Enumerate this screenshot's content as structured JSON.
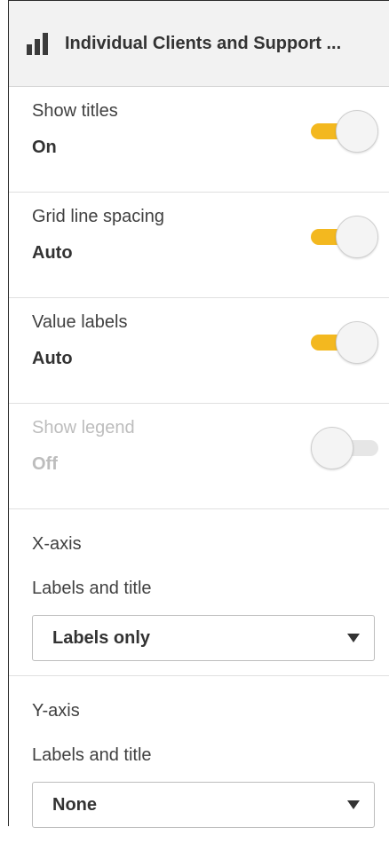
{
  "header": {
    "title": "Individual Clients and Support ..."
  },
  "settings": [
    {
      "label": "Show titles",
      "value": "On",
      "state": "on"
    },
    {
      "label": "Grid line spacing",
      "value": "Auto",
      "state": "on"
    },
    {
      "label": "Value labels",
      "value": "Auto",
      "state": "on"
    },
    {
      "label": "Show legend",
      "value": "Off",
      "state": "off"
    }
  ],
  "x_axis": {
    "title": "X-axis",
    "sub_label": "Labels and title",
    "selected": "Labels only"
  },
  "y_axis": {
    "title": "Y-axis",
    "sub_label": "Labels and title",
    "selected": "None"
  },
  "colors": {
    "toggle_on": "#f3b81f",
    "toggle_off": "#e6e6e6"
  }
}
